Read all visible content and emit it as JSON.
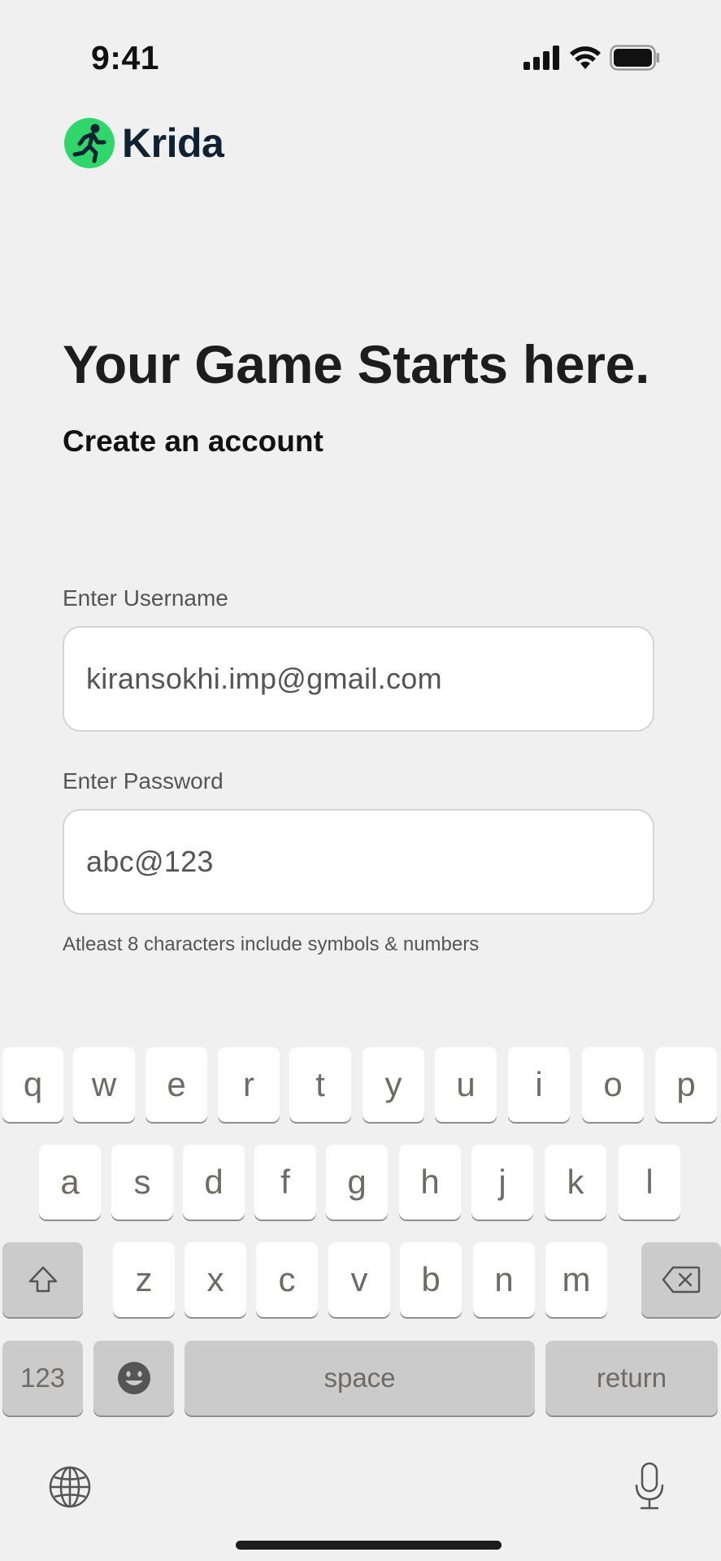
{
  "status_bar": {
    "time": "9:41"
  },
  "brand": {
    "name": "Krida",
    "accent_color": "#2fd66a",
    "logo_icon": "runner-icon"
  },
  "hero": {
    "headline": "Your Game Starts here.",
    "subheadline": "Create an account"
  },
  "form": {
    "username": {
      "label": "Enter Username",
      "value": "kiransokhi.imp@gmail.com"
    },
    "password": {
      "label": "Enter Password",
      "value": "abc@123",
      "hint": "Atleast 8 characters include symbols & numbers"
    }
  },
  "keyboard": {
    "row1": [
      "q",
      "w",
      "e",
      "r",
      "t",
      "y",
      "u",
      "i",
      "o",
      "p"
    ],
    "row2": [
      "a",
      "s",
      "d",
      "f",
      "g",
      "h",
      "j",
      "k",
      "l"
    ],
    "row3": [
      "z",
      "x",
      "c",
      "v",
      "b",
      "n",
      "m"
    ],
    "numbers_key": "123",
    "space_key": "space",
    "return_key": "return",
    "icons": [
      "shift-icon",
      "backspace-icon",
      "emoji-icon",
      "globe-icon",
      "microphone-icon"
    ]
  }
}
